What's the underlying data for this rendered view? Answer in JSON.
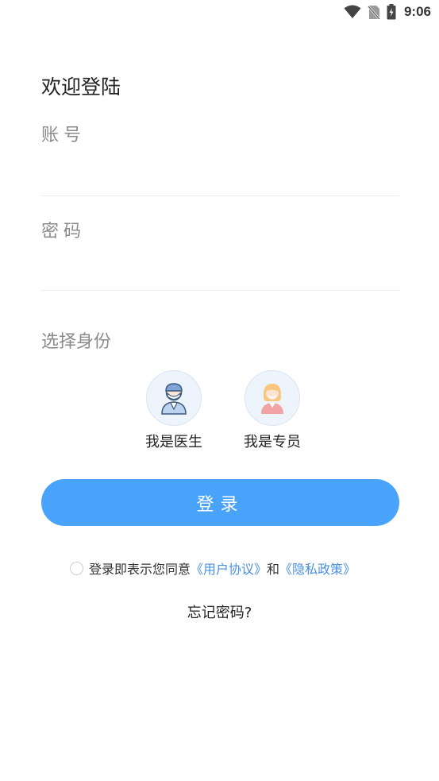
{
  "status_bar": {
    "time": "9:06",
    "icons": [
      "wifi-icon",
      "no-sim-icon",
      "battery-charging-icon"
    ]
  },
  "welcome_title": "欢迎登陆",
  "account": {
    "label": "账号",
    "value": ""
  },
  "password": {
    "label": "密码",
    "value": ""
  },
  "identity": {
    "title": "选择身份",
    "roles": [
      {
        "label": "我是医生",
        "icon": "doctor-avatar-icon"
      },
      {
        "label": "我是专员",
        "icon": "specialist-avatar-icon"
      }
    ]
  },
  "login_button": "登录",
  "agreement": {
    "prefix": "登录即表示您同意",
    "user_agreement": "《用户协议》",
    "connector": "和",
    "privacy_policy": "《隐私政策》",
    "checked": false
  },
  "forgot_password": "忘记密码?",
  "colors": {
    "primary": "#4aa3fb",
    "link": "#4a90e2",
    "hint": "#8a8a8a"
  }
}
